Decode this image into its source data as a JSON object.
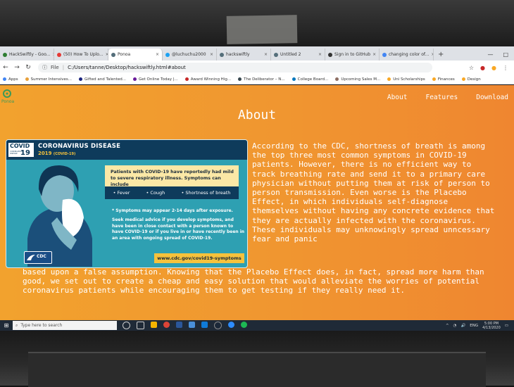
{
  "browser": {
    "tabs": [
      {
        "label": "HackSwiftly - Goo...",
        "color": "#2e7d32"
      },
      {
        "label": "(50) How To Uplo...",
        "color": "#e53935"
      },
      {
        "label": "Ponoa",
        "color": "#546e7a"
      },
      {
        "label": "@luchuchu2000",
        "color": "#1da1f2"
      },
      {
        "label": "hackswiftly",
        "color": "#546e7a"
      },
      {
        "label": "Untitled 2",
        "color": "#546e7a"
      },
      {
        "label": "Sign in to GitHub",
        "color": "#333333"
      },
      {
        "label": "changing color of...",
        "color": "#4285f4"
      }
    ],
    "new_tab": "+",
    "url_file": "File",
    "url": "C:/Users/tanne/Desktop/hackswiftly.html#about"
  },
  "bookmarks": [
    {
      "label": "Apps",
      "color": "#4285f4"
    },
    {
      "label": "Summer Intensives...",
      "color": "#e8a03a"
    },
    {
      "label": "Gifted and Talented...",
      "color": "#1a237e"
    },
    {
      "label": "Get Online Today |...",
      "color": "#6a1b9a"
    },
    {
      "label": "Award Winning Hig...",
      "color": "#c62828"
    },
    {
      "label": "The Deliberator – N...",
      "color": "#37474f"
    },
    {
      "label": "College Board...",
      "color": "#0277bd"
    },
    {
      "label": "Upcoming Sales M...",
      "color": "#8d6e63"
    },
    {
      "label": "Uni Scholarships",
      "color": "#f9a825"
    },
    {
      "label": "Finances",
      "color": "#f9a825"
    },
    {
      "label": "Design",
      "color": "#f9a825"
    }
  ],
  "site": {
    "logo_text": "Ponoa",
    "nav": [
      "About",
      "Features",
      "Download"
    ],
    "heading": "About",
    "paragraph_1": "According to the CDC, shortness of breath is among the top three most common symptoms in COVID-19 patients. However, there is no efficient way to track breathing rate and send it to a primary care physician without putting them at risk of person to person transmission. Even worse is the Placebo Effect, in which individuals self-diagnose themselves without having any concrete evidence that they are actually infected with the coronavirus. These individuals may unknowingly spread unncessary fear and panic",
    "paragraph_2": "based upon a false assumption. Knowing that the Placebo Effect does, in fact, spread more harm than good, we set out to create a cheap and easy solution that would alleviate the worries of potential coronavirus patients while encouraging them to get testing if they really need it."
  },
  "infographic": {
    "badge_word": "COVID",
    "badge_small": "CORONAVIRUS DISEASE",
    "badge_year": "19",
    "title": "CORONAVIRUS DISEASE",
    "year": "2019",
    "year_suffix": "(COVID-19)",
    "box_text": "Patients with COVID-19 have reportedly had mild to severe respiratory illness. Symptoms can include",
    "symptoms": [
      "• Fever",
      "• Cough",
      "• Shortness of breath"
    ],
    "may_appear": "* Symptoms may appear 2-14 days after exposure.",
    "advice": "Seek medical advice if you develop symptoms, and have been in close contact with a person known to have COVID-19 or if you live in or have recently been in an area with ongoing spread of COVID-19.",
    "url": "www.cdc.gov/covid19-symptoms",
    "cdc_label": "CDC"
  },
  "taskbar": {
    "search_placeholder": "Type here to search",
    "tray_text": "ENG",
    "time": "5:00 PM",
    "date": "4/13/2020"
  }
}
